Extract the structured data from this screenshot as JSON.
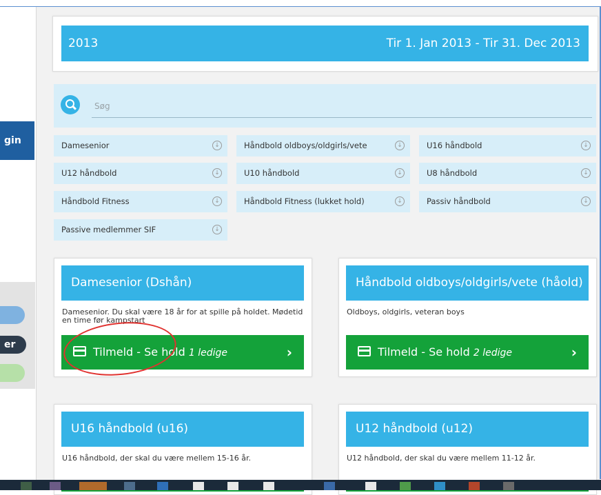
{
  "colors": {
    "accent": "#35b3e6",
    "success": "#14a23a",
    "nav": "#1f5fa0",
    "annotation": "#e0322f"
  },
  "sidebar": {
    "login_label": "gin",
    "pill_label": "er"
  },
  "period": {
    "year": "2013",
    "range": "Tir 1. Jan 2013  -  Tir 31. Dec 2013"
  },
  "search": {
    "placeholder": "Søg"
  },
  "filters": [
    {
      "label": "Damesenior",
      "icon": "chevron-down-circle-icon"
    },
    {
      "label": "Håndbold oldboys/oldgirls/vete",
      "icon": "chevron-down-circle-icon"
    },
    {
      "label": "U16 håndbold",
      "icon": "chevron-down-circle-icon"
    },
    {
      "label": "U12 håndbold",
      "icon": "chevron-down-circle-icon"
    },
    {
      "label": "U10 håndbold",
      "icon": "chevron-down-circle-icon"
    },
    {
      "label": "U8 håndbold",
      "icon": "chevron-down-circle-icon"
    },
    {
      "label": "Håndbold Fitness",
      "icon": "chevron-down-circle-icon"
    },
    {
      "label": "Håndbold Fitness (lukket hold)",
      "icon": "chevron-down-circle-icon"
    },
    {
      "label": "Passiv håndbold",
      "icon": "chevron-down-circle-icon"
    },
    {
      "label": "Passive medlemmer SIF",
      "icon": "chevron-down-circle-icon"
    }
  ],
  "teams": [
    {
      "title": "Damesenior (Dshån)",
      "description": "Damesenior. Du skal være 18 år for at spille på holdet. Mødetid en time før kampstart",
      "button_label": "Tilmeld - Se hold",
      "availability": "1 ledige"
    },
    {
      "title": "Håndbold oldboys/oldgirls/vete (håold)",
      "description": "Oldboys, oldgirls, veteran boys",
      "button_label": "Tilmeld - Se hold",
      "availability": "2 ledige"
    },
    {
      "title": "U16 håndbold (u16)",
      "description": "U16 håndbold, der skal du være mellem 15-16 år."
    },
    {
      "title": "U12 håndbold (u12)",
      "description": "U12 håndbold, der skal du være mellem 11-12 år."
    }
  ]
}
